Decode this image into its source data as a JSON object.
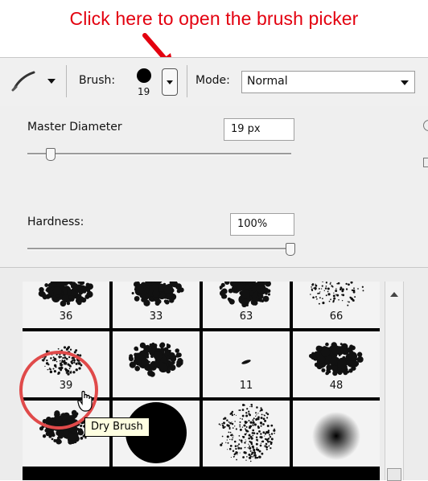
{
  "annotation": {
    "text": "Click here to open the brush picker",
    "color": "#e3000f"
  },
  "options_bar": {
    "tool_icon": "brush-icon",
    "brush_label": "Brush:",
    "brush_size": "19",
    "mode_label": "Mode:",
    "mode_value": "Normal"
  },
  "panel": {
    "master_diameter_label": "Master Diameter",
    "master_diameter_value": "19 px",
    "hardness_label": "Hardness:",
    "hardness_value": "100%",
    "diameter_slider_fraction": 0.09,
    "hardness_slider_fraction": 1.0
  },
  "brushes": [
    {
      "size": "36",
      "type": "splatter"
    },
    {
      "size": "33",
      "type": "splatter"
    },
    {
      "size": "63",
      "type": "splatter"
    },
    {
      "size": "66",
      "type": "scatter"
    },
    {
      "size": "39",
      "type": "dry",
      "selected": true
    },
    {
      "size": "",
      "type": "splatter"
    },
    {
      "size": "11",
      "type": "small"
    },
    {
      "size": "48",
      "type": "splatter"
    },
    {
      "size": "",
      "type": "splatter"
    },
    {
      "size": "",
      "type": "hard-round"
    },
    {
      "size": "",
      "type": "scatter-round"
    },
    {
      "size": "",
      "type": "soft-round"
    }
  ],
  "tooltip": {
    "text": "Dry Brush"
  },
  "highlight_color": "#e04a4a"
}
